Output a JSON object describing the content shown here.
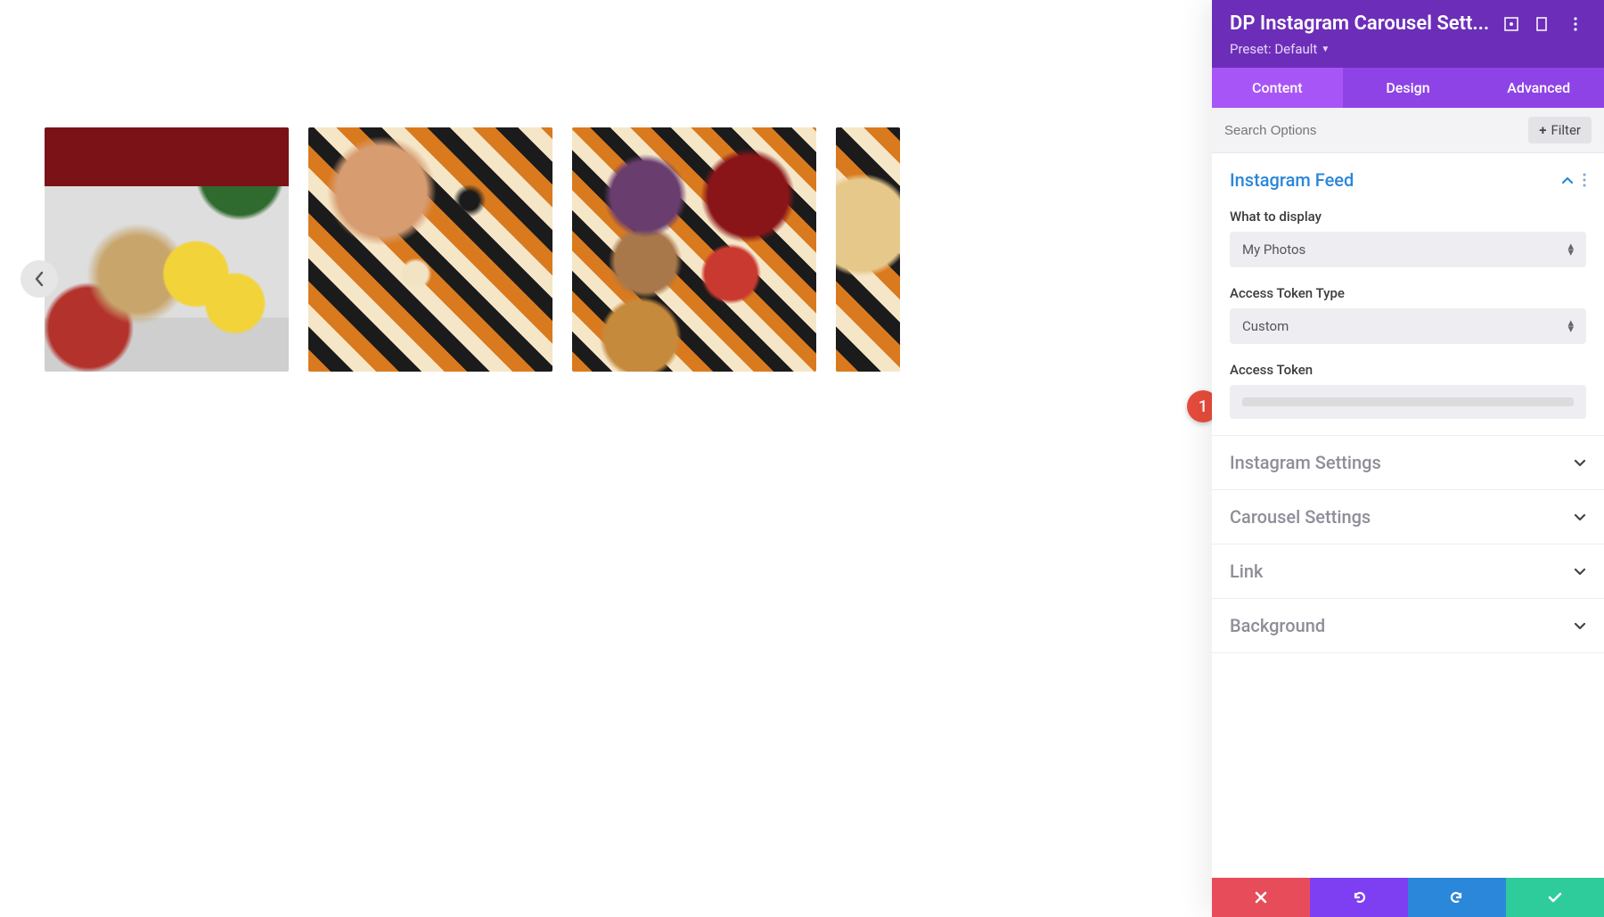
{
  "header": {
    "title": "DP Instagram Carousel Sett...",
    "preset_label": "Preset: Default"
  },
  "tabs": {
    "content": "Content",
    "design": "Design",
    "advanced": "Advanced"
  },
  "search": {
    "placeholder": "Search Options",
    "filter_label": "Filter"
  },
  "sections": {
    "instagram_feed": {
      "title": "Instagram Feed",
      "what_label": "What to display",
      "what_value": "My Photos",
      "token_type_label": "Access Token Type",
      "token_type_value": "Custom",
      "token_label": "Access Token"
    },
    "instagram_settings": "Instagram Settings",
    "carousel_settings": "Carousel Settings",
    "link": "Link",
    "background": "Background"
  },
  "badge": {
    "number": "1"
  }
}
